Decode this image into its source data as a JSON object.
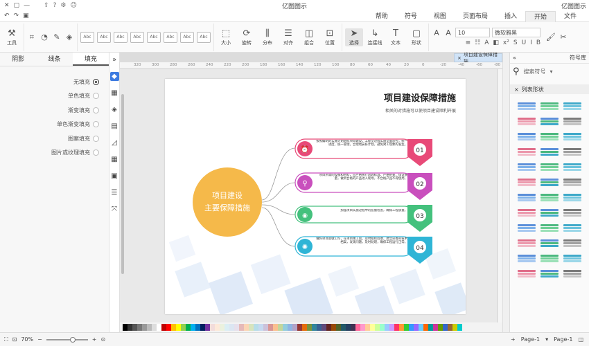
{
  "titlebar": {
    "app_title": "亿图图示",
    "logo_label": "亿图图示"
  },
  "menu": {
    "tabs": [
      "文件",
      "开始",
      "插入",
      "页面布局",
      "视图",
      "符号",
      "帮助"
    ],
    "active": "开始"
  },
  "ribbon": {
    "tool_label": "工具",
    "font_name": "微软雅黑",
    "font_size": "10",
    "style_box_label": "Abc",
    "big_buttons": [
      {
        "label": "选择",
        "icon": "pointer-icon"
      },
      {
        "label": "连接线",
        "icon": "connector-icon"
      },
      {
        "label": "文本",
        "icon": "text-icon"
      },
      {
        "label": "形状",
        "icon": "shape-icon"
      }
    ],
    "arrange_buttons": [
      "位置",
      "组合",
      "对齐",
      "分布",
      "大小",
      "旋转"
    ]
  },
  "left_panel": {
    "tabs": [
      "填充",
      "线条",
      "阴影"
    ],
    "active_tab": "填充",
    "options": [
      "无填充",
      "单色填充",
      "渐变填充",
      "单色渐变填充",
      "图案填充",
      "图片或纹理填充"
    ],
    "selected_index": 0
  },
  "canvas": {
    "doc_tab": "项目建设保障措施",
    "ruler_ticks": [
      "320",
      "300",
      "280",
      "260",
      "240",
      "220",
      "200",
      "180",
      "160",
      "140",
      "120",
      "100",
      "80",
      "60",
      "40",
      "20",
      "0",
      "-20",
      "-40",
      "-60",
      "-80"
    ]
  },
  "diagram": {
    "title": "项目建设保障措施",
    "subtitle": "相关的对措施可以使项目建设顺利开展",
    "center_line1": "项目建设",
    "center_line2": "主要保障措施",
    "items": [
      {
        "num": "01",
        "color": "#e84a78",
        "icon": "clock-icon",
        "text": "按照编制的实施计划组织项目建设，工程全过程实施全面监控，统一进度，统一管理，合理地安排计划，避免窝工现象的发生。"
      },
      {
        "num": "02",
        "color": "#c94fbd",
        "icon": "bicycle-icon",
        "text": "项目所需的设备和材料，应严格执行验收标准，严格把关，保证质量，做到合格的产品进入现场，不合格产品不得使用。"
      },
      {
        "num": "03",
        "color": "#44c17d",
        "icon": "camera-icon",
        "text": "加强项目实施过程中的监督检查，确保工程质量。"
      },
      {
        "num": "04",
        "color": "#2fb5d6",
        "icon": "bulb-icon",
        "text": "做好项目验收工作，在项目竣工后，及时组织验收，建立完善的技术档案，发现问题，及时处理，确保工程运行正常。"
      }
    ]
  },
  "status": {
    "page_label": "Page-1",
    "page_tab": "Page-1",
    "zoom": "70%"
  },
  "right_panel": {
    "title": "符号库",
    "search_placeholder": "搜索符号",
    "section": "列表形状"
  },
  "palette": [
    "#000000",
    "#333333",
    "#555555",
    "#777777",
    "#999999",
    "#bbbbbb",
    "#dddddd",
    "#ffffff",
    "#c00000",
    "#ff0000",
    "#ffc000",
    "#ffff00",
    "#92d050",
    "#00b050",
    "#00b0f0",
    "#0070c0",
    "#002060",
    "#7030a0",
    "#f2dcdb",
    "#fde9d9",
    "#ebf1de",
    "#dbeef4",
    "#dce6f2",
    "#e6e0ec",
    "#e6b9b8",
    "#fbd5b5",
    "#d7e4bd",
    "#b7dde8",
    "#c6d9f1",
    "#ccc1da",
    "#d99694",
    "#fac090",
    "#c3d69b",
    "#93cddd",
    "#8eb4e3",
    "#b3a2c7",
    "#953735",
    "#e46c0a",
    "#77933c",
    "#31859c",
    "#376092",
    "#604a7b",
    "#632523",
    "#974806",
    "#4f6228",
    "#215968",
    "#254061",
    "#403152",
    "#ff6699",
    "#ff99cc",
    "#ffcc99",
    "#ffff99",
    "#ccff99",
    "#99ffcc",
    "#99ccff",
    "#cc99ff",
    "#ff3366",
    "#ff9933",
    "#33cc33",
    "#3399ff",
    "#9966ff",
    "#66ccff",
    "#ff6600",
    "#009999",
    "#cc3399",
    "#669900",
    "#3366cc",
    "#996633",
    "#cccc00",
    "#00cccc"
  ]
}
